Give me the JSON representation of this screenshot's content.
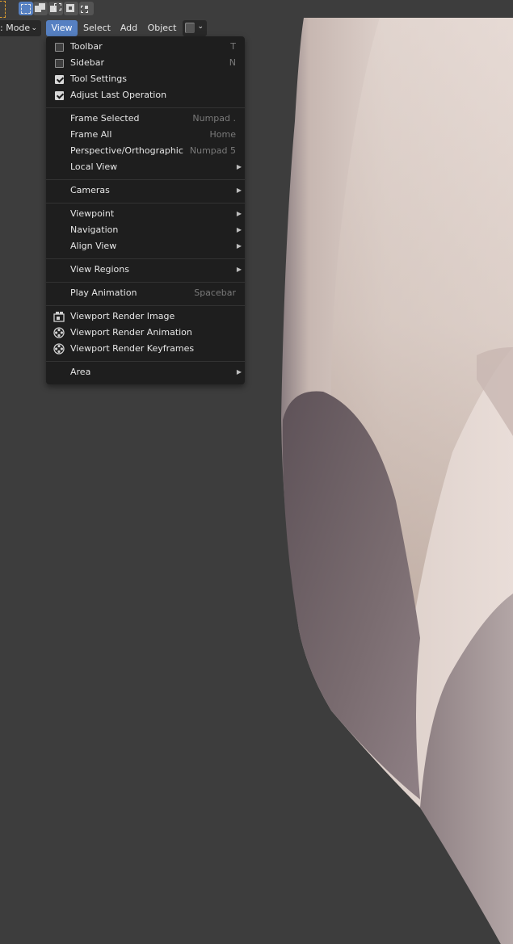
{
  "header": {
    "mode_label": ": Mode",
    "menus": [
      "View",
      "Select",
      "Add",
      "Object"
    ],
    "active_menu": "View"
  },
  "toolbar": {
    "select_modes": [
      "select-box-icon",
      "select-extend-icon",
      "select-subtract-icon",
      "select-invert-icon",
      "select-intersect-icon"
    ]
  },
  "view_menu": {
    "items": [
      {
        "label": "Toolbar",
        "shortcut": "T",
        "checkbox": true,
        "checked": false
      },
      {
        "label": "Sidebar",
        "shortcut": "N",
        "checkbox": true,
        "checked": false
      },
      {
        "label": "Tool Settings",
        "shortcut": "",
        "checkbox": true,
        "checked": true
      },
      {
        "label": "Adjust Last Operation",
        "shortcut": "",
        "checkbox": true,
        "checked": true
      },
      {
        "label": "Frame Selected",
        "shortcut": "Numpad ."
      },
      {
        "label": "Frame All",
        "shortcut": "Home"
      },
      {
        "label": "Perspective/Orthographic",
        "shortcut": "Numpad 5"
      },
      {
        "label": "Local View",
        "submenu": true
      },
      {
        "label": "Cameras",
        "submenu": true
      },
      {
        "label": "Viewpoint",
        "submenu": true
      },
      {
        "label": "Navigation",
        "submenu": true
      },
      {
        "label": "Align View",
        "submenu": true
      },
      {
        "label": "View Regions",
        "submenu": true
      },
      {
        "label": "Play Animation",
        "shortcut": "Spacebar"
      },
      {
        "label": "Viewport Render Image",
        "icon": "render-image-icon"
      },
      {
        "label": "Viewport Render Animation",
        "icon": "render-animation-icon"
      },
      {
        "label": "Viewport Render Keyframes",
        "icon": "render-animation-icon"
      },
      {
        "label": "Area",
        "submenu": true
      }
    ]
  },
  "colors": {
    "accent": "#5680c2",
    "menu_bg": "#1e1e1e",
    "viewport_bg": "#3d3d3d"
  }
}
